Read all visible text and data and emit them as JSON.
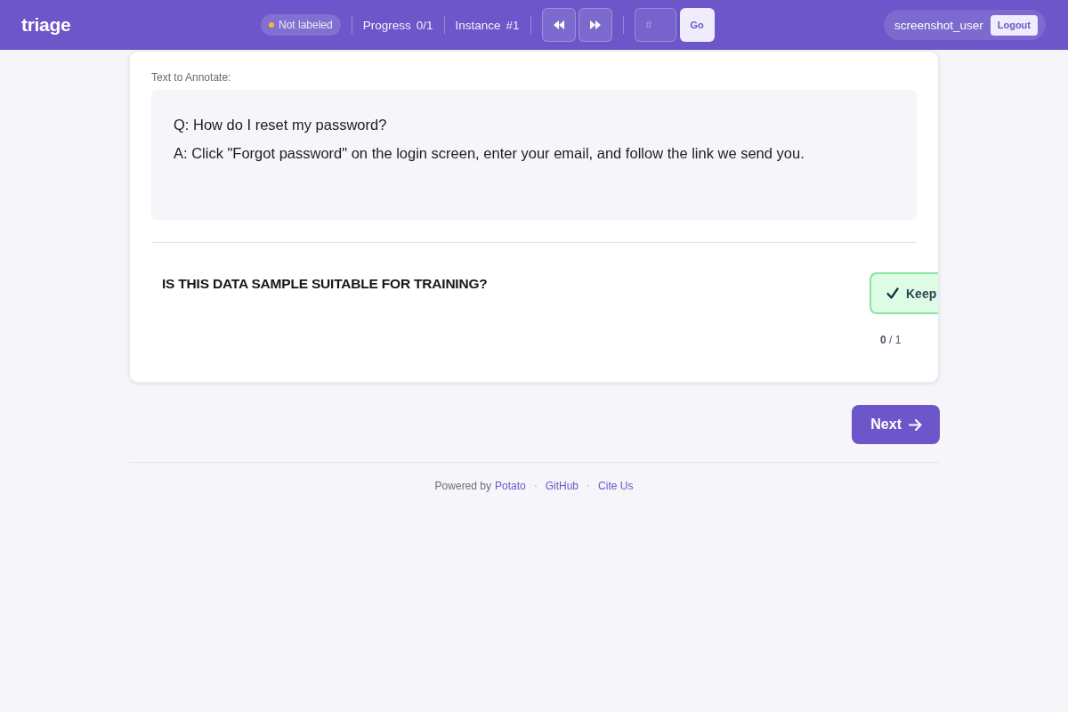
{
  "header": {
    "logo": "triage",
    "status": {
      "label": "Not labeled",
      "labeled": false
    },
    "progress": {
      "label": "Progress",
      "value": "0/1"
    },
    "instance": {
      "label": "Instance",
      "value": "#1"
    },
    "jump": {
      "placeholder": "#",
      "button": "Go"
    },
    "user": {
      "name": "screenshot_user",
      "logout": "Logout"
    }
  },
  "annotation": {
    "label": "Text to Annotate:",
    "lines": [
      "Q: How do I reset my password?",
      "A: Click \"Forgot password\" on the login screen, enter your email, and follow the link we send you."
    ]
  },
  "question": {
    "title": "IS THIS DATA SAMPLE SUITABLE FOR TRAINING?",
    "options": [
      {
        "label": "Keep",
        "selected": false
      }
    ],
    "counter": "**0** / 1"
  },
  "next_button": "Next",
  "footer": {
    "prefix": "Powered by",
    "links": [
      "Potato",
      "GitHub",
      "Cite Us"
    ]
  }
}
